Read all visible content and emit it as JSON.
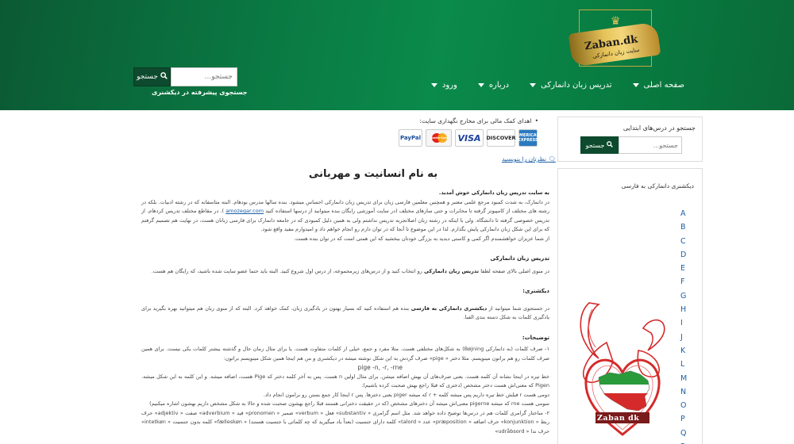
{
  "header": {
    "logo_text": "Zaban.dk",
    "logo_sub": "سایت زبان دانمارکی",
    "search_button": "جستجو",
    "search_placeholder": "جستجو...",
    "advanced_search": "جستجوی پیشرفته در دیکشنری",
    "nav": [
      {
        "label": "صفحه اصلی",
        "has_dropdown": true
      },
      {
        "label": "تدریس زبان دانمارکی",
        "has_dropdown": true
      },
      {
        "label": "درباره",
        "has_dropdown": true
      },
      {
        "label": "ورود",
        "has_dropdown": true
      }
    ]
  },
  "sidebar": {
    "search_label": "جستجو در درس‌های ابتدایی",
    "search_button": "جستجو",
    "search_placeholder": "جستجو...",
    "dictionary_title": "دیکشنری دانمارکی به فارسی",
    "letters": [
      "A",
      "B",
      "C",
      "D",
      "E",
      "F",
      "G",
      "H",
      "I",
      "J",
      "K",
      "L",
      "M",
      "N",
      "O",
      "P",
      "Q",
      "R"
    ],
    "emblem_text": "Zaban dk"
  },
  "main": {
    "donate_text": "اهدای کمک مالی برای مخارج نگهداری سایت:",
    "cards": [
      "PayPal",
      "MasterCard",
      "VISA",
      "DISCOVER",
      "AMERICAN EXPRESS"
    ],
    "comment_link": "نظرتان را بنویسید",
    "title": "به نام انسانیت و مهربانی",
    "welcome": "به سایت تدریس زبان دانمارکی خوش آمدید.",
    "intro_p1": "در دانمارک، به شدت کمبود مرجع علمی معتبر و همچنین معلمین فارسی زبان برای تدریس زبان دانمارکی احساس میشود. بنده سالها مدرس بودهام. البته متاسفانه که در رشته ادبیات. بلکه در رشته های مختلف از کامپیوتر گرفته تا مخابرات و حتی سازهای مختلف (در سایت آموزشی رایگان بنده میتوانید از درسها استفاده کنید",
    "intro_link": "amozegar.com",
    "intro_p1b": "). در مقاطع مختلف تدریس کردهام. از تدریس خصوصی گرفته تا دانشگاه. ولی با اینکه در رشته زبان اصلاتجربه تدریس نداشتم ولی به همین دلیل کمبودی که در جامعه دانمارک برای فارسی زبانان هست، در نهایت هم تصمیم گرفتم که برای این شکل زبان دانمارکی پایش بگذارم. لذا در این موضوع تا آنجا که در توان دارم رو انجام خواهم داد و امیدوارم مفید واقع شود.",
    "intro_p2": "از شما عزیزان خواهشمندم اگر کمی و کاستی دیدید به بزرگی خودتان ببخشید که این همتی است که در توان بنده هست.",
    "section1_head": "تدریس زبان دانمارکی",
    "section1_text_a": "در منوی اصلی بالای صفحه لطفا",
    "section1_bold": "تدریس زبان دانمارکی",
    "section1_text_b": "رو انتخاب کنید و از درس‌های زیرمجموعه، از درس اول شروع کنید. البته باید حتما عضو سایت شده باشید، که رایگان هم هست.",
    "section2_head": "دیکشنری:",
    "section2_text_a": "در جستجوی شما میتوانید از",
    "section2_bold": "دیکشنری دانمارکی به فارسی",
    "section2_text_b": "بنده هم استفاده کنید که بسیار بهتون در یادگیری زبان، کمک خواهد کرد. البته که از منوی زبان هم میتوانید بهره بگیرید برای یادگیری کلمات به شکل دسته بندی الفبا.",
    "section3_head": "توضیحات:",
    "notes": [
      "۱- صرف کلمات (به دانمارکی Bøjning) به شکل‌های مختلفی هست. مثلا مفرد و جمع، خیلی از کلمات متفاوت هست. یا برای مثال زمان حال و گذشته بیشتر کلمات یکی نیست. برای همین صرف کلمات رو هم براتون مینویسم. مثلا دختر « pige» صرف گردش به این شکل نوشته میشه در دیکشنری و من هم اینجا همین شکل مینویسم براتون:",
      "pige -n, -r, -rne",
      "خط تیره در اینجا نشانه آن کلمه هست. یعنی صرف‌های آن بهش اضافه میشن. برای مثال اولین n هست. پس به آخر کلمه دختر که Pige هست، اضافه میشه. و این کلمه به این شکل میشه. Pigen که معنی‌اش هست دختر مشخص (دختری که قبلا راجع بهش صحبت کرده باشیم).",
      "دومی هست r فبلش خط تیره داریم پس میشه کلمه + r که میشه piger یعنی دخترها. پس r اینجا کار جمع بستن رو برامون انجام داد.",
      "سومی هست rne که میشه pigerne معنی‌اش میشه آن دخترهای مشخص (که در حقیقت دخترانی هستند قبلا راجع بهشون صحبت شده و حالا به شکل مشخص داریم بهشون اشاره میکنیم)",
      "۲- ساختار گرامری کلمات هم در درس‌ها توضیح داده خواهد شد. مثل اسم گرامری « substantiv» فعل « verbum» ضمیر « pronomen» قید « adverbium» صفت « adjektiv» حرف ربط « konjunktion» حرف اضافه « præposition» عدد « talord» کلمه دارای جنسیت (بعداً یاد میگیرید که چه کلماتی با جنسیت هستند) « fælleskøn» کلمه بدون جنسیت « intetkøn» حرف ندا « udråbsord»"
    ]
  },
  "colors": {
    "header_green": "#0a7a43",
    "button_dark_green": "#0d4a2e",
    "link_blue": "#1a5fa8"
  }
}
